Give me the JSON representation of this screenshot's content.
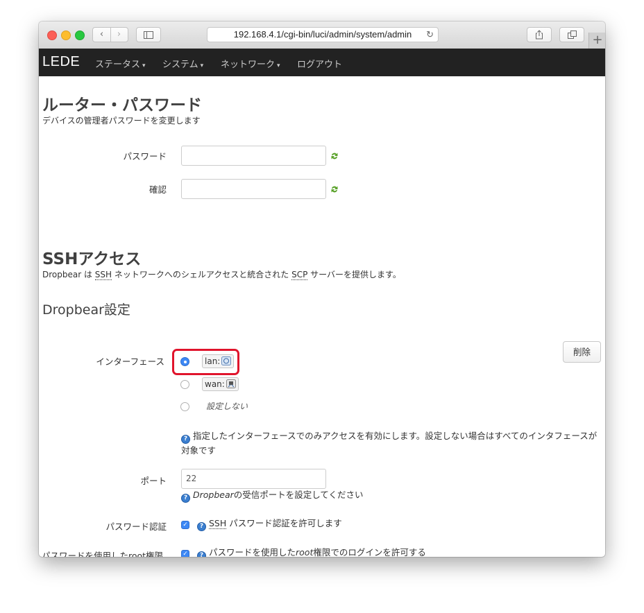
{
  "browser": {
    "url": "192.168.4.1/cgi-bin/luci/admin/system/admin",
    "new_tab_label": "+"
  },
  "nav": {
    "brand": "LEDE",
    "menus": [
      {
        "label": "ステータス",
        "caret": "▾"
      },
      {
        "label": "システム",
        "caret": "▾"
      },
      {
        "label": "ネットワーク",
        "caret": "▾"
      },
      {
        "label": "ログアウト",
        "caret": ""
      }
    ]
  },
  "router_password": {
    "title": "ルーター・パスワード",
    "description": "デバイスの管理者パスワードを変更します",
    "password_label": "パスワード",
    "password_value": "",
    "confirm_label": "確認",
    "confirm_value": ""
  },
  "ssh": {
    "title": "SSHアクセス",
    "desc_part1": "Dropbear は ",
    "desc_ssh": "SSH",
    "desc_part2": " ネットワークへのシェルアクセスと統合された ",
    "desc_scp": "SCP",
    "desc_part3": " サーバーを提供します。"
  },
  "dropbear": {
    "title": "Dropbear設定",
    "delete_label": "削除",
    "interface_label": "インターフェース",
    "interfaces": [
      {
        "label": "lan:",
        "selected": true
      },
      {
        "label": "wan:",
        "selected": false
      },
      {
        "label": "設定しない",
        "selected": false
      }
    ],
    "interface_help": "指定したインターフェースでのみアクセスを有効にします。設定しない場合はすべてのインタフェースが対象です",
    "port_label": "ポート",
    "port_value": "22",
    "port_help_em": "Dropbear",
    "port_help_rest": "の受信ポートを設定してください",
    "password_auth_label": "パスワード認証",
    "password_auth_checked": true,
    "password_auth_help_abbr": "SSH",
    "password_auth_help_rest": " パスワード認証を許可します",
    "root_login_label": "パスワードを使用したroot権限",
    "root_login_checked": true,
    "root_login_help_1": "パスワードを使用した",
    "root_login_help_em": "root",
    "root_login_help_2": "権限でのログインを許可する"
  },
  "colors": {
    "navbar_bg": "#222222",
    "accent_blue": "#3d88f5",
    "highlight_red": "#e0142c"
  }
}
